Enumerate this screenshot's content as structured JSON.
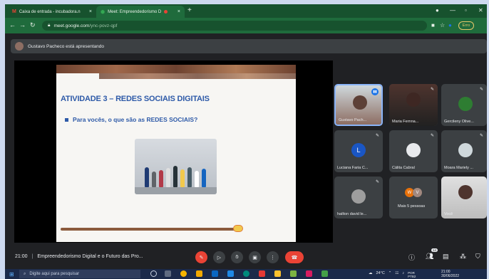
{
  "browser": {
    "tabs": [
      {
        "icon": "M",
        "title": "Caixa de entrada - incubadora.n",
        "close": "×"
      },
      {
        "icon": "⬢",
        "title": "Meet: Empreendedorismo D",
        "close": "×"
      }
    ],
    "new_tab": "+",
    "address": {
      "domain": "meet.google.com",
      "path": "/ync-povz-qpf"
    },
    "profile_label": "Erro"
  },
  "banner": {
    "text": "Gustavo Pacheco está apresentando"
  },
  "slide": {
    "title": "ATIVIDADE 3 – REDES SOCIAIS DIGITAIS",
    "bullet": "Para vocês, o que são as REDES SOCIAIS?"
  },
  "participants": [
    {
      "name": "Gustavo Pach..."
    },
    {
      "name": "Maria Fernna..."
    },
    {
      "name": "Gercileny Olive..."
    },
    {
      "name": "Luciana Faria C...",
      "initial": "L"
    },
    {
      "name": "Cálita Cabral"
    },
    {
      "name": "Moara Mariely ..."
    },
    {
      "name": "hailton david le..."
    },
    {
      "name": "Mais 5 pessoas"
    },
    {
      "name": "Você"
    }
  ],
  "more_initials": [
    "W",
    "V"
  ],
  "meeting": {
    "time": "21:00",
    "separator": "|",
    "title": "Empreendedorismo Digital e o Futuro das Pro..."
  },
  "participant_count": "14",
  "taskbar": {
    "search_placeholder": "Digite aqui para pesquisar",
    "weather": "24°C",
    "lang": "POR",
    "lang_sub": "PTB2",
    "time": "21:00",
    "date": "30/06/2022"
  },
  "colors": {
    "accent": "#8ab4f8",
    "hangup": "#ea4335",
    "tab_bg": "#17522e",
    "slide_text": "#2e5aa8"
  }
}
